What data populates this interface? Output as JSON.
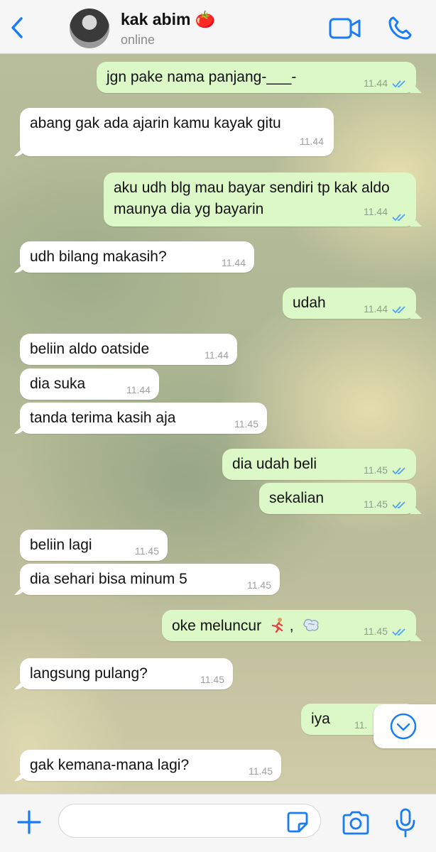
{
  "header": {
    "contact_name": "kak abim 🍅",
    "status": "online",
    "icons": {
      "back": "chevron-left-icon",
      "video": "video-camera-icon",
      "phone": "phone-icon"
    },
    "accent_color": "#1a7cf5"
  },
  "messages": [
    {
      "dir": "out",
      "text": "jgn pake nama panjang-___-",
      "time": "11.44",
      "read": true
    },
    {
      "dir": "in",
      "text": "abang gak ada ajarin kamu kayak gitu",
      "time": "11.44"
    },
    {
      "dir": "out",
      "text": "aku udh blg mau bayar sendiri tp kak aldo maunya dia yg bayarin",
      "time": "11.44",
      "read": true
    },
    {
      "dir": "in",
      "text": "udh bilang makasih?",
      "time": "11.44"
    },
    {
      "dir": "out",
      "text": "udah",
      "time": "11.44",
      "read": true
    },
    {
      "dir": "in",
      "text": "beliin aldo oatside",
      "time": "11.44"
    },
    {
      "dir": "in",
      "text": "dia suka",
      "time": "11.44"
    },
    {
      "dir": "in",
      "text": "tanda terima kasih aja",
      "time": "11.45"
    },
    {
      "dir": "out",
      "text": "dia udah beli",
      "time": "11.45",
      "read": true
    },
    {
      "dir": "out",
      "text": "sekalian",
      "time": "11.45",
      "read": true
    },
    {
      "dir": "in",
      "text": "beliin lagi",
      "time": "11.45"
    },
    {
      "dir": "in",
      "text": "dia sehari bisa minum 5",
      "time": "11.45"
    },
    {
      "dir": "out",
      "text": "oke meluncur",
      "time": "11.45",
      "read": true,
      "emoji": [
        "running-person-icon",
        "dash-cloud-icon"
      ]
    },
    {
      "dir": "in",
      "text": "langsung pulang?",
      "time": "11.45"
    },
    {
      "dir": "out",
      "text": "iya",
      "time": "11.",
      "read": true
    },
    {
      "dir": "in",
      "text": "gak kemana-mana lagi?",
      "time": "11.45"
    }
  ],
  "colors": {
    "incoming_bubble": "#ffffff",
    "outgoing_bubble": "#dcf8c6",
    "read_ticks": "#4fa3f7"
  },
  "input_bar": {
    "placeholder": "",
    "icons": [
      "plus-icon",
      "sticker-icon",
      "camera-icon",
      "microphone-icon"
    ]
  },
  "scroll_button_icon": "chevron-down-icon"
}
